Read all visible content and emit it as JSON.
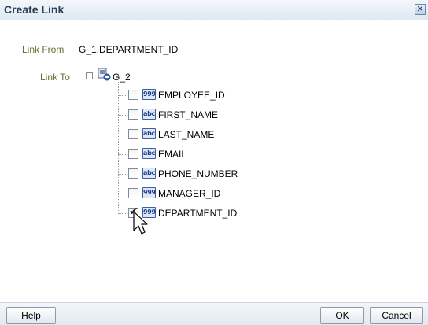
{
  "dialog": {
    "title": "Create Link",
    "close_glyph": "✕"
  },
  "form": {
    "link_from_label": "Link From",
    "link_from_value": "G_1.DEPARTMENT_ID",
    "link_to_label": "Link To"
  },
  "tree": {
    "root_label": "G_2",
    "root_icon": "group-icon",
    "items": [
      {
        "name": "EMPLOYEE_ID",
        "type": "999",
        "checked": false
      },
      {
        "name": "FIRST_NAME",
        "type": "abc",
        "checked": false
      },
      {
        "name": "LAST_NAME",
        "type": "abc",
        "checked": false
      },
      {
        "name": "EMAIL",
        "type": "abc",
        "checked": false
      },
      {
        "name": "PHONE_NUMBER",
        "type": "abc",
        "checked": false
      },
      {
        "name": "MANAGER_ID",
        "type": "999",
        "checked": false
      },
      {
        "name": "DEPARTMENT_ID",
        "type": "999",
        "checked": true
      }
    ]
  },
  "buttons": {
    "help": "Help",
    "ok": "OK",
    "cancel": "Cancel"
  },
  "colors": {
    "label": "#6b6b32",
    "title": "#2a3f5a",
    "type_icon_border": "#3b5ea5"
  }
}
